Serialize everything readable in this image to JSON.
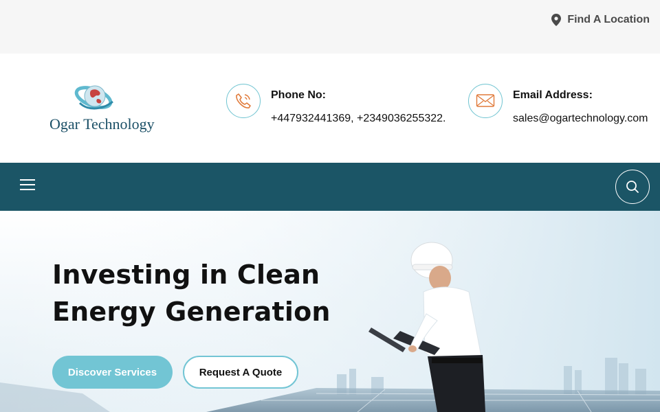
{
  "topbar": {
    "find_location": "Find A Location",
    "pin_icon": "map-pin-icon"
  },
  "header": {
    "logo_text": "Ogar Technology",
    "phone": {
      "icon": "phone-icon",
      "label": "Phone No:",
      "value": "+447932441369, +2349036255322."
    },
    "email": {
      "icon": "envelope-icon",
      "label": "Email Address:",
      "value": "sales@ogartechnology.com"
    }
  },
  "nav": {
    "menu_icon": "hamburger-menu-icon",
    "search_icon": "search-icon"
  },
  "hero": {
    "title_line1": "Investing in Clean",
    "title_line2": "Energy Generation",
    "primary_button": "Discover Services",
    "secondary_button": "Request A Quote"
  },
  "colors": {
    "brand_dark": "#1b5566",
    "accent": "#72c5d4",
    "phone_icon": "#e07a3a"
  }
}
